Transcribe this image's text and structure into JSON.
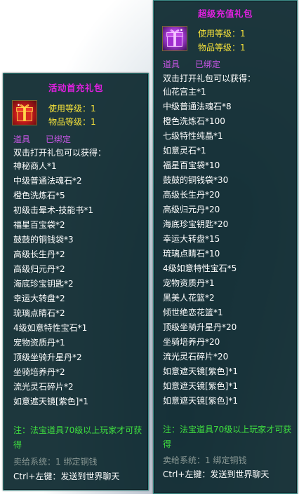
{
  "tooltip_left": {
    "title": "活动首充礼包",
    "use_level": "使用等级：1",
    "item_level": "物品等级：1",
    "tag_type": "道具",
    "tag_bind": "已绑定",
    "description": "双击打开礼包可以获得：",
    "items": [
      "神秘商人*1",
      "中级普通法魂石*2",
      "橙色洗炼石*5",
      "初级击晕术-技能书*1",
      "福星百宝袋*2",
      "鼓鼓的铜钱袋*3",
      "高级长生丹*2",
      "高级归元丹*2",
      "海底珍宝钥匙*2",
      "幸运大转盘*2",
      "琉璃点睛石*2",
      "4级如意特性宝石*1",
      "宠物资质丹*1",
      "顶级坐骑升星丹*2",
      "坐骑培养丹*2",
      "流光灵石碎片*2",
      "如意遮天镜[紫色]*1"
    ],
    "note": "注：法宝道具70级以上玩家才可获得",
    "seller": "卖给系统：1 绑定铜钱",
    "ctrl_hint": "Ctrl+左键：发送到世界聊天",
    "icon": "red-gift-box-icon"
  },
  "tooltip_right": {
    "title": "超级充值礼包",
    "use_level": "使用等级：1",
    "item_level": "物品等级：1",
    "tag_type": "道具",
    "tag_bind": "已绑定",
    "description": "双击打开礼包可以获得：",
    "items": [
      "仙花宫主*1",
      "中级普通法魂石*8",
      "橙色洗炼石*100",
      "七级特性纯晶*1",
      "如意灵石*1",
      "福星百宝袋*10",
      "鼓鼓的铜钱袋*30",
      "高级长生丹*20",
      "高级归元丹*20",
      "海底珍宝钥匙*20",
      "幸运大转盘*15",
      "琉璃点睛石*10",
      "4级如意特性宝石*5",
      "宠物资质丹*1",
      "黑美人花篮*2",
      "倾世绝恋花篮*1",
      "顶级坐骑升星丹*20",
      "坐骑培养丹*20",
      "流光灵石碎片*20",
      "如意遮天镜[紫色]*1",
      "如意遮天镜[紫色]*1",
      "如意遮天镜[紫色]*1"
    ],
    "note": "注：法宝道具70级以上玩家才可获得",
    "seller": "卖给系统：1 绑定铜钱",
    "ctrl_hint": "Ctrl+左键：发送到世界聊天",
    "icon": "purple-gift-box-icon"
  },
  "colors": {
    "title": "#e020e0",
    "level": "#f6e23a",
    "tag": "#c956e6",
    "note": "#3fe03f",
    "seller": "#8a9894",
    "panel_bg": "#0a262c"
  }
}
